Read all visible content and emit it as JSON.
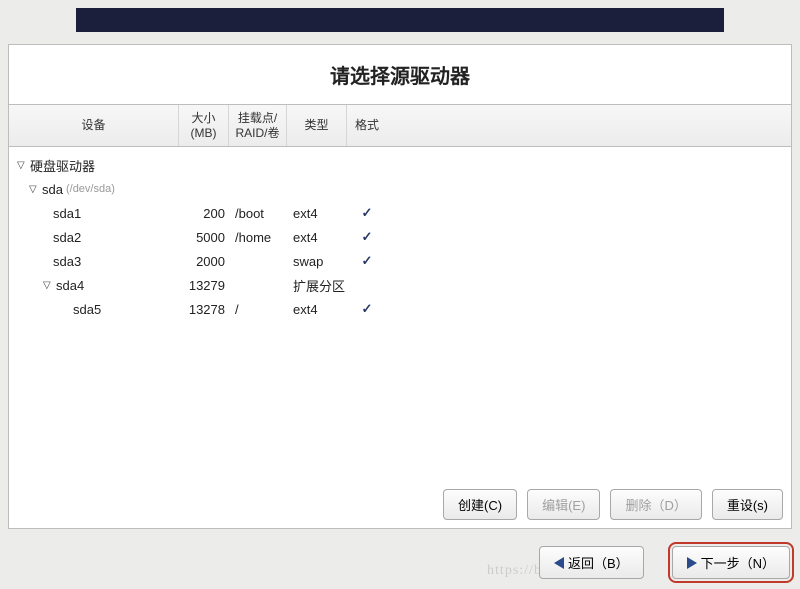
{
  "title": "请选择源驱动器",
  "columns": {
    "device": "设备",
    "size": "大小\n(MB)",
    "mount": "挂载点/\nRAID/卷",
    "type": "类型",
    "format": "格式"
  },
  "tree": {
    "root_label": "硬盘驱动器",
    "disk": {
      "name": "sda",
      "path": "(/dev/sda)"
    },
    "parts": [
      {
        "name": "sda1",
        "size": "200",
        "mount": "/boot",
        "type": "ext4",
        "fmt": "✓"
      },
      {
        "name": "sda2",
        "size": "5000",
        "mount": "/home",
        "type": "ext4",
        "fmt": "✓"
      },
      {
        "name": "sda3",
        "size": "2000",
        "mount": "",
        "type": "swap",
        "fmt": "✓"
      },
      {
        "name": "sda4",
        "size": "13279",
        "mount": "",
        "type": "扩展分区",
        "fmt": "",
        "expandable": true
      },
      {
        "name": "sda5",
        "size": "13278",
        "mount": "/",
        "type": "ext4",
        "fmt": "✓",
        "child": true
      }
    ]
  },
  "buttons": {
    "create": "创建(C)",
    "edit": "编辑(E)",
    "delete": "删除（D）",
    "reset": "重设(s)"
  },
  "nav": {
    "back": "返回（B）",
    "next": "下一步（N）"
  },
  "watermark": "https://blog.csdn.net/..."
}
